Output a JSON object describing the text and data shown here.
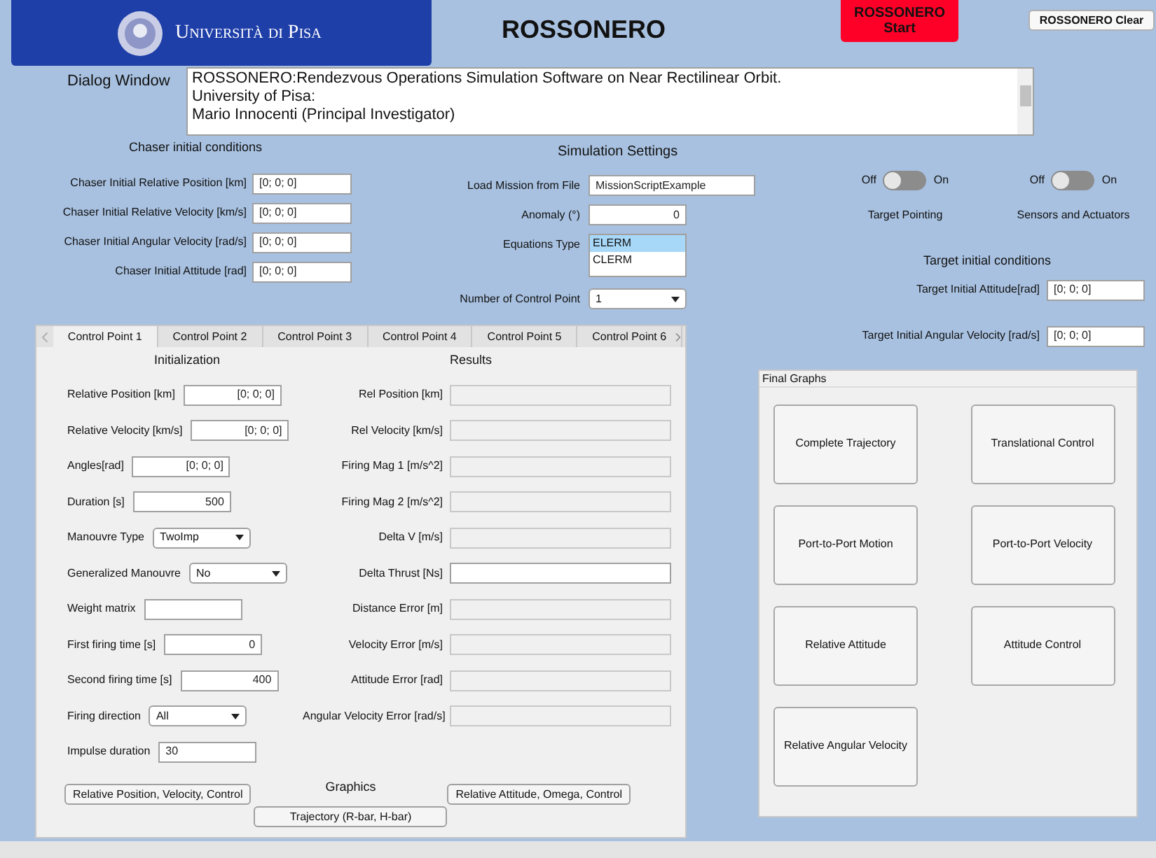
{
  "header": {
    "university": "Università di Pisa",
    "title": "ROSSONERO",
    "start_button": "ROSSONERO\nStart",
    "clear_button": "ROSSONERO Clear"
  },
  "dialog": {
    "label": "Dialog Window",
    "lines": [
      "ROSSONERO:Rendezvous Operations Simulation Software on Near Rectilinear Orbit.",
      "University of Pisa:",
      "Mario Innocenti (Principal Investigator)"
    ]
  },
  "chaser": {
    "title": "Chaser initial conditions",
    "rows": [
      {
        "label": "Chaser Initial Relative Position [km]",
        "value": "[0; 0; 0]"
      },
      {
        "label": "Chaser Initial Relative Velocity [km/s]",
        "value": "[0; 0; 0]"
      },
      {
        "label": "Chaser Initial Angular Velocity [rad/s]",
        "value": "[0; 0; 0]"
      },
      {
        "label": "Chaser Initial Attitude [rad]",
        "value": "[0; 0; 0]"
      }
    ]
  },
  "simulation": {
    "title": "Simulation Settings",
    "load_label": "Load Mission from File",
    "load_value": "MissionScriptExample",
    "anomaly_label": "Anomaly (°)",
    "anomaly_value": "0",
    "equations_label": "Equations Type",
    "equations": [
      {
        "label": "ELERM",
        "selected": true
      },
      {
        "label": "CLERM",
        "selected": false
      }
    ],
    "control_points_label": "Number of Control Point",
    "control_points_value": "1"
  },
  "toggles": [
    {
      "off": "Off",
      "on_label": "On",
      "on": false,
      "caption": "Target Pointing"
    },
    {
      "off": "Off",
      "on_label": "On",
      "on": false,
      "caption": "Sensors and Actuators"
    }
  ],
  "target": {
    "title": "Target initial conditions",
    "rows": [
      {
        "label": "Target Initial Attitude[rad]",
        "value": "[0; 0; 0]"
      },
      {
        "label": "Target Initial Angular Velocity [rad/s]",
        "value": "[0; 0; 0]"
      }
    ]
  },
  "tabs": [
    {
      "label": "Control Point 1",
      "selected": true
    },
    {
      "label": "Control Point 2",
      "selected": false
    },
    {
      "label": "Control Point 3",
      "selected": false
    },
    {
      "label": "Control Point 4",
      "selected": false
    },
    {
      "label": "Control Point 5",
      "selected": false
    },
    {
      "label": "Control Point 6",
      "selected": false
    }
  ],
  "initialization": {
    "title": "Initialization",
    "rows": [
      {
        "kind": "text",
        "label": "Relative Position [km]",
        "value": "[0; 0; 0]",
        "right_aligned": true
      },
      {
        "kind": "text",
        "label": "Relative Velocity [km/s]",
        "value": "[0; 0; 0]",
        "right_aligned": true
      },
      {
        "kind": "text",
        "label": "Angles[rad]",
        "value": "[0; 0; 0]",
        "right_aligned": true
      },
      {
        "kind": "text",
        "label": "Duration [s]",
        "value": "500",
        "right_aligned": true
      },
      {
        "kind": "dropdown",
        "label": "Manouvre Type",
        "value": "TwoImp"
      },
      {
        "kind": "dropdown",
        "label": "Generalized Manouvre",
        "value": "No"
      },
      {
        "kind": "text",
        "label": "Weight matrix",
        "value": ""
      },
      {
        "kind": "text",
        "label": "First firing time [s]",
        "value": "0",
        "right_aligned": true
      },
      {
        "kind": "text",
        "label": "Second firing time [s]",
        "value": "400",
        "right_aligned": true
      },
      {
        "kind": "dropdown",
        "label": "Firing direction",
        "value": "All"
      },
      {
        "kind": "text",
        "label": "Impulse duration",
        "value": "30",
        "right_aligned": false
      }
    ]
  },
  "results": {
    "title": "Results",
    "rows": [
      {
        "label": "Rel Position [km]",
        "disabled": true
      },
      {
        "label": "Rel Velocity [km/s]",
        "disabled": true
      },
      {
        "label": "Firing Mag 1 [m/s^2]",
        "disabled": true
      },
      {
        "label": "Firing Mag 2 [m/s^2]",
        "disabled": true
      },
      {
        "label": "Delta V [m/s]",
        "disabled": true
      },
      {
        "label": "Delta Thrust [Ns]",
        "disabled": false
      },
      {
        "label": "Distance Error [m]",
        "disabled": true
      },
      {
        "label": "Velocity Error [m/s]",
        "disabled": true
      },
      {
        "label": "Attitude Error [rad]",
        "disabled": true
      },
      {
        "label": "Angular Velocity Error [rad/s]",
        "disabled": true
      }
    ]
  },
  "graphics": {
    "title": "Graphics",
    "buttons": [
      "Relative Position, Velocity, Control",
      "Relative Attitude, Omega, Control",
      "Trajectory (R-bar, H-bar)"
    ]
  },
  "final_graphs": {
    "title": "Final Graphs",
    "buttons": [
      "Complete Trajectory",
      "Translational Control",
      "Port-to-Port Motion",
      "Port-to-Port Velocity",
      "Relative Attitude",
      "Attitude Control",
      "Relative Angular Velocity"
    ]
  }
}
